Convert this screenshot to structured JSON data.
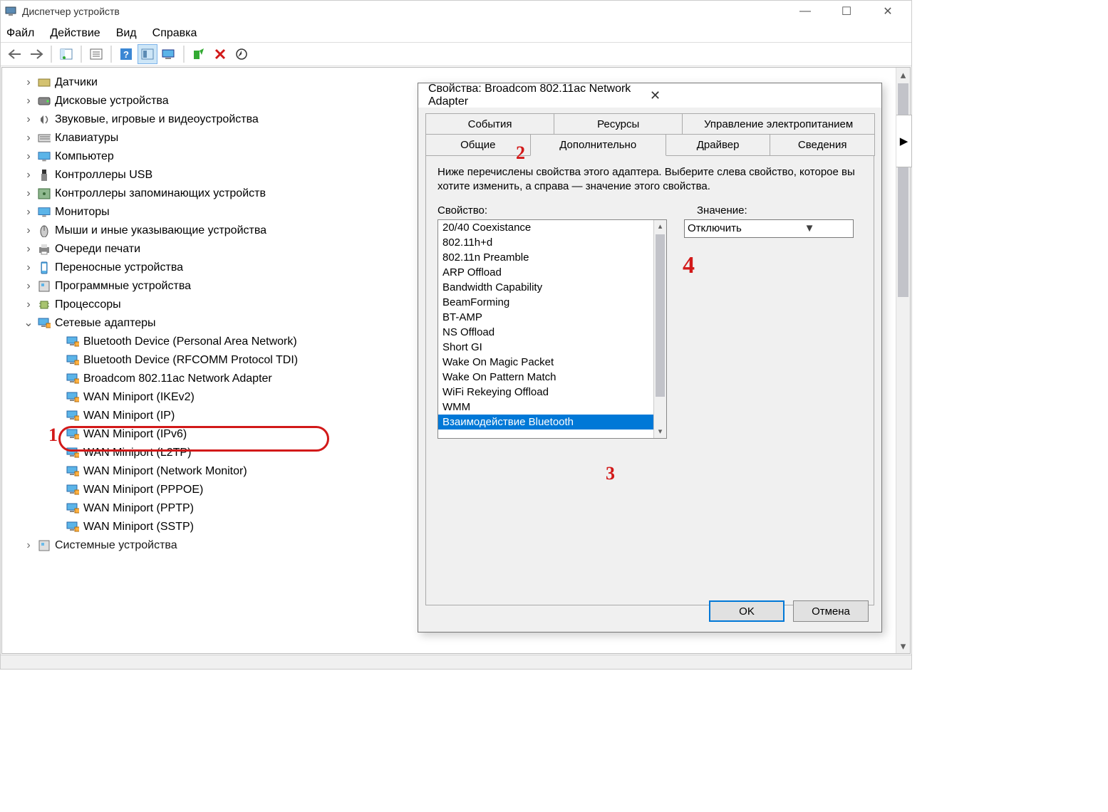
{
  "window": {
    "title": "Диспетчер устройств"
  },
  "menubar": {
    "file": "Файл",
    "action": "Действие",
    "view": "Вид",
    "help": "Справка"
  },
  "tree": {
    "items": [
      {
        "label": "Датчики",
        "icon": "sensor"
      },
      {
        "label": "Дисковые устройства",
        "icon": "disk"
      },
      {
        "label": "Звуковые, игровые и видеоустройства",
        "icon": "sound"
      },
      {
        "label": "Клавиатуры",
        "icon": "keyboard"
      },
      {
        "label": "Компьютер",
        "icon": "computer"
      },
      {
        "label": "Контроллеры USB",
        "icon": "usb"
      },
      {
        "label": "Контроллеры запоминающих устройств",
        "icon": "storage"
      },
      {
        "label": "Мониторы",
        "icon": "monitor"
      },
      {
        "label": "Мыши и иные указывающие устройства",
        "icon": "mouse"
      },
      {
        "label": "Очереди печати",
        "icon": "printer"
      },
      {
        "label": "Переносные устройства",
        "icon": "portable"
      },
      {
        "label": "Программные устройства",
        "icon": "software"
      },
      {
        "label": "Процессоры",
        "icon": "cpu"
      },
      {
        "label": "Сетевые адаптеры",
        "icon": "network",
        "expanded": true
      }
    ],
    "network_children": [
      "Bluetooth Device (Personal Area Network)",
      "Bluetooth Device (RFCOMM Protocol TDI)",
      "Broadcom 802.11ac Network Adapter",
      "WAN Miniport (IKEv2)",
      "WAN Miniport (IP)",
      "WAN Miniport (IPv6)",
      "WAN Miniport (L2TP)",
      "WAN Miniport (Network Monitor)",
      "WAN Miniport (PPPOE)",
      "WAN Miniport (PPTP)",
      "WAN Miniport (SSTP)"
    ],
    "last_item": "Системные устройства"
  },
  "dialog": {
    "title": "Свойства: Broadcom 802.11ac Network Adapter",
    "tabs_row1": [
      "События",
      "Ресурсы",
      "Управление электропитанием"
    ],
    "tabs_row2": [
      "Общие",
      "Дополнительно",
      "Драйвер",
      "Сведения"
    ],
    "active_tab": "Дополнительно",
    "description": "Ниже перечислены свойства этого адаптера. Выберите слева свойство, которое вы хотите изменить, а справа — значение этого свойства.",
    "property_label": "Свойство:",
    "value_label": "Значение:",
    "properties": [
      "20/40 Coexistance",
      "802.11h+d",
      "802.11n Preamble",
      "ARP Offload",
      "Bandwidth Capability",
      "BeamForming",
      "BT-AMP",
      "NS Offload",
      "Short GI",
      "Wake On Magic Packet",
      "Wake On Pattern Match",
      "WiFi Rekeying Offload",
      "WMM",
      "Взаимодействие Bluetooth"
    ],
    "selected_property": "Взаимодействие Bluetooth",
    "value_selected": "Отключить",
    "ok": "OK",
    "cancel": "Отмена"
  },
  "annotations": {
    "n1": "1",
    "n2": "2",
    "n3": "3",
    "n4": "4"
  }
}
